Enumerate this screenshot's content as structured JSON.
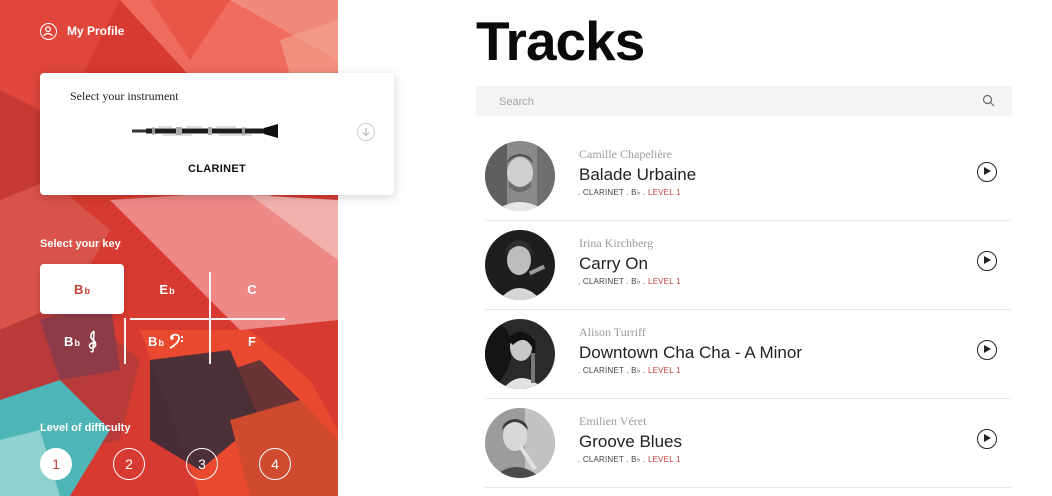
{
  "sidebar": {
    "profile_label": "My Profile",
    "instrument": {
      "title": "Select your instrument",
      "name": "CLARINET"
    },
    "key": {
      "title": "Select your key",
      "options": [
        {
          "note": "B",
          "acc": "b",
          "clef": "",
          "selected": true
        },
        {
          "note": "E",
          "acc": "b",
          "clef": "",
          "selected": false
        },
        {
          "note": "C",
          "acc": "",
          "clef": "",
          "selected": false
        },
        {
          "note": "B",
          "acc": "b",
          "clef": "treble",
          "selected": false
        },
        {
          "note": "B",
          "acc": "b",
          "clef": "bass",
          "selected": false
        },
        {
          "note": "F",
          "acc": "",
          "clef": "",
          "selected": false
        }
      ]
    },
    "level": {
      "title": "Level of difficulty",
      "options": [
        "1",
        "2",
        "3",
        "4"
      ],
      "selected": "1"
    }
  },
  "main": {
    "title": "Tracks",
    "search": {
      "placeholder": "Search"
    },
    "tracks": [
      {
        "artist": "Camille Chapelière",
        "title": "Balade Urbaine",
        "meta": ". CLARINET . B♭ .",
        "level": "LEVEL 1"
      },
      {
        "artist": "Irina Kirchberg",
        "title": "Carry On",
        "meta": ". CLARINET . B♭ .",
        "level": "LEVEL 1"
      },
      {
        "artist": "Alison Turriff",
        "title": "Downtown Cha Cha - A Minor",
        "meta": ". CLARINET . B♭ .",
        "level": "LEVEL 1"
      },
      {
        "artist": "Emilien Véret",
        "title": "Groove Blues",
        "meta": ". CLARINET . B♭ .",
        "level": "LEVEL 1"
      }
    ]
  },
  "colors": {
    "accent": "#c4413a",
    "art_red": "#d63a30",
    "art_teal": "#4fb6b8"
  },
  "icons": [
    "profile-icon",
    "download-icon",
    "search-icon",
    "play-icon",
    "treble-clef-icon",
    "bass-clef-icon"
  ]
}
